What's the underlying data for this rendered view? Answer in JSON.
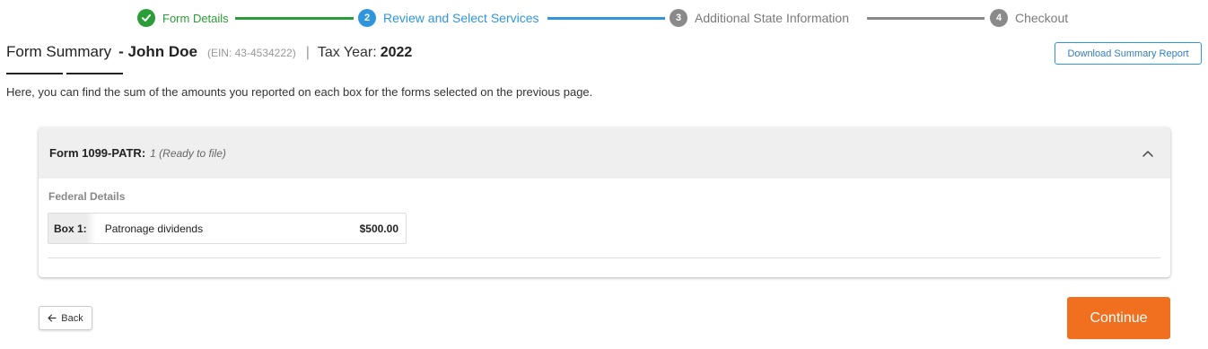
{
  "stepper": {
    "steps": [
      {
        "number": "",
        "label": "Form Details",
        "state": "complete",
        "icon": "checkmark-icon"
      },
      {
        "number": "2",
        "label": "Review and Select Services",
        "state": "active"
      },
      {
        "number": "3",
        "label": "Additional State Information",
        "state": "pending"
      },
      {
        "number": "4",
        "label": "Checkout",
        "state": "pending"
      }
    ],
    "colors": {
      "complete": "#2a9d38",
      "active": "#2f96de",
      "pending": "#8a8a8a"
    }
  },
  "header": {
    "title": "Form Summary",
    "name": "- John Doe",
    "ein": "(EIN: 43-4534222)",
    "separator": "|",
    "tax_year_label": "Tax Year:",
    "tax_year": "2022",
    "download_button": "Download Summary Report"
  },
  "intro_text": "Here, you can find the sum of the amounts you reported on each box for the forms selected on the previous page.",
  "form_card": {
    "form_name": "Form 1099-PATR:",
    "form_status": "1 (Ready to file)",
    "toggle_icon": "chevron-up-icon",
    "section_label": "Federal Details",
    "boxes": [
      {
        "box": "Box 1:",
        "description": "Patronage dividends",
        "amount": "$500.00"
      }
    ]
  },
  "footer": {
    "back_label": "Back",
    "back_icon": "arrow-left-icon",
    "continue_label": "Continue",
    "continue_color": "#f07020"
  }
}
